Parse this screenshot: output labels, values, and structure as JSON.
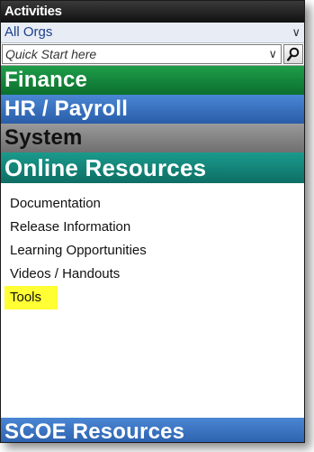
{
  "header": {
    "title": "Activities"
  },
  "org": {
    "selected": "All Orgs"
  },
  "search": {
    "placeholder": "Quick Start here"
  },
  "sections": {
    "finance": "Finance",
    "hr": "HR / Payroll",
    "system": "System",
    "online": "Online Resources",
    "scoe": "SCOE Resources"
  },
  "links": [
    {
      "label": "Documentation"
    },
    {
      "label": "Release Information"
    },
    {
      "label": "Learning Opportunities"
    },
    {
      "label": "Videos / Handouts"
    },
    {
      "label": "Tools",
      "highlight_color": "#ffff33"
    }
  ],
  "icons": {
    "dropdown": "chevron-down-icon",
    "search": "magnifier-icon"
  }
}
